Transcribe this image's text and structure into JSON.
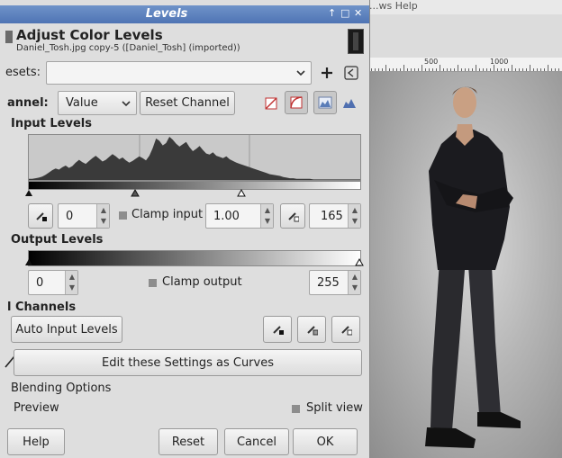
{
  "background_window": {
    "menu_fragment": "...ws Help",
    "ruler_labels": [
      "500",
      "1000"
    ]
  },
  "dialog": {
    "window_title": "Levels",
    "title_controls": [
      "↑",
      "□",
      "✕"
    ],
    "header_title": "Adjust Color Levels",
    "header_subtitle": "Daniel_Tosh.jpg copy-5 ([Daniel_Tosh] (imported))",
    "presets_label": "esets:",
    "presets_value": "",
    "channel_label": "annel:",
    "channel_value": "Value",
    "reset_channel_label": "Reset Channel",
    "input_levels_heading": "Input Levels",
    "input_low": "0",
    "clamp_input_label": "Clamp input",
    "gamma": "1.00",
    "input_high": "165",
    "output_levels_heading": "Output Levels",
    "output_low": "0",
    "clamp_output_label": "Clamp output",
    "output_high": "255",
    "all_channels_heading": "l Channels",
    "auto_input_levels_label": "Auto Input Levels",
    "edit_curves_label": "Edit these Settings as Curves",
    "blending_options_label": "Blending Options",
    "preview_label": "Preview",
    "split_view_label": "Split view",
    "help_label": "Help",
    "reset_label": "Reset",
    "cancel_label": "Cancel",
    "ok_label": "OK"
  },
  "histogram": {
    "values": [
      2,
      2,
      3,
      4,
      6,
      9,
      13,
      17,
      20,
      18,
      22,
      25,
      21,
      24,
      30,
      35,
      31,
      28,
      33,
      38,
      42,
      37,
      32,
      35,
      40,
      45,
      41,
      36,
      39,
      34,
      30,
      33,
      37,
      41,
      38,
      34,
      42,
      55,
      72,
      68,
      60,
      64,
      75,
      70,
      63,
      58,
      62,
      66,
      57,
      50,
      54,
      59,
      52,
      46,
      44,
      48,
      42,
      40,
      38,
      41,
      36,
      33,
      30,
      28,
      26,
      24,
      22,
      20,
      18,
      16,
      14,
      12,
      10,
      9,
      8,
      7,
      5,
      4,
      3,
      3,
      2,
      2,
      2,
      2,
      2,
      1,
      1,
      1,
      1,
      1,
      1,
      1,
      1,
      1,
      1,
      1,
      1,
      1,
      1,
      1
    ],
    "max": 75
  },
  "colors": {
    "title_bar": "#4f74b4",
    "dialog_bg": "#dedede",
    "histogram_fill": "#3a3a3a",
    "histogram_bg": "#c9c9c9"
  }
}
